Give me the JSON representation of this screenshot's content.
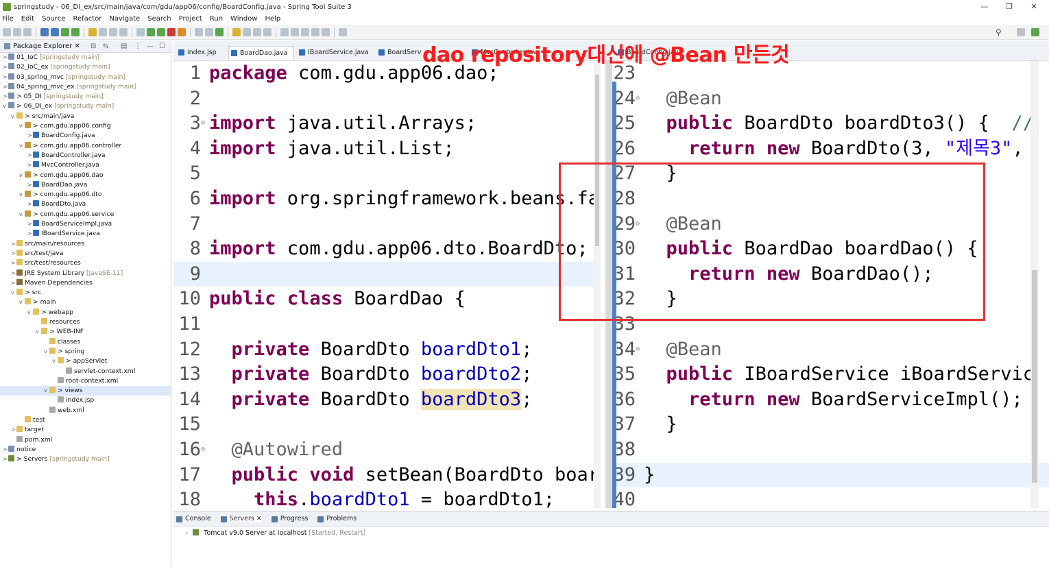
{
  "window": {
    "title": "springstudy - 06_DI_ex/src/main/java/com/gdu/app06/config/BoardConfig.java - Spring Tool Suite 3",
    "controls": [
      "—",
      "❐",
      "✕"
    ]
  },
  "menu": [
    "File",
    "Edit",
    "Source",
    "Refactor",
    "Navigate",
    "Search",
    "Project",
    "Run",
    "Window",
    "Help"
  ],
  "package_explorer": {
    "title": "Package Explorer ✕",
    "items": [
      {
        "text": "01_IoC",
        "dim": "[springstudy main]",
        "icon": "proj",
        "indent": 0,
        "tw": ">"
      },
      {
        "text": "02_IoC_ex",
        "dim": "[springstudy main]",
        "icon": "proj",
        "indent": 0,
        "tw": ">"
      },
      {
        "text": "03_spring_mvc",
        "dim": "[springstudy main]",
        "icon": "proj",
        "indent": 0,
        "tw": ">"
      },
      {
        "text": "04_spring_mvc_ex",
        "dim": "[springstudy main]",
        "icon": "proj",
        "indent": 0,
        "tw": ">"
      },
      {
        "text": "> 05_DI",
        "dim": "[springstudy main]",
        "icon": "proj",
        "indent": 0,
        "tw": ">"
      },
      {
        "text": "> 06_DI_ex",
        "dim": "[springstudy main]",
        "icon": "proj",
        "indent": 0,
        "tw": "v"
      },
      {
        "text": "> src/main/java",
        "dim": "",
        "icon": "fold",
        "indent": 1,
        "tw": "v"
      },
      {
        "text": "> com.gdu.app06.config",
        "dim": "",
        "icon": "pkg",
        "indent": 2,
        "tw": "v"
      },
      {
        "text": "BoardConfig.java",
        "dim": "",
        "icon": "java",
        "indent": 3,
        "tw": ">"
      },
      {
        "text": "> com.gdu.app06.controller",
        "dim": "",
        "icon": "pkg",
        "indent": 2,
        "tw": "v"
      },
      {
        "text": "BoardController.java",
        "dim": "",
        "icon": "java",
        "indent": 3,
        "tw": ">"
      },
      {
        "text": "MvcController.java",
        "dim": "",
        "icon": "java",
        "indent": 3,
        "tw": ">"
      },
      {
        "text": "> com.gdu.app06.dao",
        "dim": "",
        "icon": "pkg",
        "indent": 2,
        "tw": "v"
      },
      {
        "text": "BoardDao.java",
        "dim": "",
        "icon": "java",
        "indent": 3,
        "tw": ">"
      },
      {
        "text": "> com.gdu.app06.dto",
        "dim": "",
        "icon": "pkg",
        "indent": 2,
        "tw": "v"
      },
      {
        "text": "BoardDto.java",
        "dim": "",
        "icon": "java",
        "indent": 3,
        "tw": ">"
      },
      {
        "text": "> com.gdu.app06.service",
        "dim": "",
        "icon": "pkg",
        "indent": 2,
        "tw": "v"
      },
      {
        "text": "BoardServiceImpl.java",
        "dim": "",
        "icon": "java",
        "indent": 3,
        "tw": ">"
      },
      {
        "text": "IBoardService.java",
        "dim": "",
        "icon": "java",
        "indent": 3,
        "tw": ">"
      },
      {
        "text": "src/main/resources",
        "dim": "",
        "icon": "fold",
        "indent": 1,
        "tw": ">"
      },
      {
        "text": "src/test/java",
        "dim": "",
        "icon": "fold",
        "indent": 1,
        "tw": ">"
      },
      {
        "text": "src/test/resources",
        "dim": "",
        "icon": "fold",
        "indent": 1,
        "tw": ">"
      },
      {
        "text": "JRE System Library",
        "dim": "[JavaSE-11]",
        "icon": "lib",
        "indent": 1,
        "tw": ">"
      },
      {
        "text": "Maven Dependencies",
        "dim": "",
        "icon": "lib",
        "indent": 1,
        "tw": ">"
      },
      {
        "text": "> src",
        "dim": "",
        "icon": "fold",
        "indent": 1,
        "tw": "v"
      },
      {
        "text": "> main",
        "dim": "",
        "icon": "fold",
        "indent": 2,
        "tw": "v"
      },
      {
        "text": "> webapp",
        "dim": "",
        "icon": "fold",
        "indent": 3,
        "tw": "v"
      },
      {
        "text": "resources",
        "dim": "",
        "icon": "fold",
        "indent": 4,
        "tw": ""
      },
      {
        "text": "> WEB-INF",
        "dim": "",
        "icon": "fold",
        "indent": 4,
        "tw": "v"
      },
      {
        "text": "classes",
        "dim": "",
        "icon": "fold",
        "indent": 5,
        "tw": ""
      },
      {
        "text": "> spring",
        "dim": "",
        "icon": "fold",
        "indent": 5,
        "tw": "v"
      },
      {
        "text": "> appServlet",
        "dim": "",
        "icon": "fold",
        "indent": 6,
        "tw": "v"
      },
      {
        "text": "servlet-context.xml",
        "dim": "",
        "icon": "file",
        "indent": 7,
        "tw": ""
      },
      {
        "text": "root-context.xml",
        "dim": "",
        "icon": "file",
        "indent": 6,
        "tw": ""
      },
      {
        "text": "> views",
        "dim": "",
        "icon": "fold",
        "indent": 5,
        "tw": "v",
        "selected": true
      },
      {
        "text": "index.jsp",
        "dim": "",
        "icon": "file",
        "indent": 6,
        "tw": ""
      },
      {
        "text": "web.xml",
        "dim": "",
        "icon": "file",
        "indent": 5,
        "tw": ""
      },
      {
        "text": "test",
        "dim": "",
        "icon": "fold",
        "indent": 2,
        "tw": ""
      },
      {
        "text": "target",
        "dim": "",
        "icon": "fold",
        "indent": 1,
        "tw": ">"
      },
      {
        "text": "pom.xml",
        "dim": "",
        "icon": "file",
        "indent": 1,
        "tw": ""
      },
      {
        "text": "notice",
        "dim": "",
        "icon": "proj",
        "indent": 0,
        "tw": ">"
      },
      {
        "text": "> Servers",
        "dim": "[springstudy main]",
        "icon": "srv",
        "indent": 0,
        "tw": ">"
      }
    ]
  },
  "editor_tabs": [
    {
      "label": "index.jsp",
      "active": false
    },
    {
      "label": "BoardDao.java ✕",
      "active": true
    },
    {
      "label": "IBoardService.java",
      "active": false
    },
    {
      "label": "BoardServiceImpl.java",
      "active": false
    },
    {
      "label": "MvcController.java",
      "active": false
    },
    {
      "label": "BoardConfig.java",
      "active": false
    }
  ],
  "left_editor": {
    "lines": [
      {
        "n": "1",
        "fold": "",
        "html": "<span class='kw'>package</span> com.gdu.app06.dao;"
      },
      {
        "n": "2",
        "fold": "",
        "html": ""
      },
      {
        "n": "3",
        "fold": "⊖",
        "html": "<span class='kw'>import</span> java.util.Arrays;"
      },
      {
        "n": "4",
        "fold": "",
        "html": "<span class='kw'>import</span> java.util.List;"
      },
      {
        "n": "5",
        "fold": "",
        "html": ""
      },
      {
        "n": "6",
        "fold": "",
        "html": "<span class='kw'>import</span> org.springframework.beans.fa"
      },
      {
        "n": "7",
        "fold": "",
        "html": ""
      },
      {
        "n": "8",
        "fold": "",
        "html": "<span class='kw'>import</span> com.gdu.app06.dto.BoardDto;"
      },
      {
        "n": "9",
        "fold": "",
        "html": "",
        "hl": true
      },
      {
        "n": "10",
        "fold": "",
        "html": "<span class='kw'>public</span> <span class='kw'>class</span> BoardDao {"
      },
      {
        "n": "11",
        "fold": "",
        "html": ""
      },
      {
        "n": "12",
        "fold": "",
        "html": "  <span class='kw'>private</span> BoardDto <span class='fld'>boardDto1</span>;"
      },
      {
        "n": "13",
        "fold": "",
        "html": "  <span class='kw'>private</span> BoardDto <span class='fld'>boardDto2</span>;"
      },
      {
        "n": "14",
        "fold": "",
        "html": "  <span class='kw'>private</span> BoardDto <span class='fld occ'>boardDto3</span>;"
      },
      {
        "n": "15",
        "fold": "",
        "html": ""
      },
      {
        "n": "16",
        "fold": "⊖",
        "html": "  <span class='ann'>@Autowired</span>"
      },
      {
        "n": "17",
        "fold": "",
        "html": "  <span class='kw'>public</span> <span class='kw'>void</span> setBean(BoardDto boar"
      },
      {
        "n": "18",
        "fold": "",
        "html": "    <span class='kw'>this</span>.<span class='fld'>boardDto1</span> = boardDto1;"
      }
    ]
  },
  "right_editor": {
    "lines": [
      {
        "n": "23",
        "fold": "",
        "html": ""
      },
      {
        "n": "24",
        "fold": "⊖",
        "html": "  <span class='ann'>@Bean</span>"
      },
      {
        "n": "25",
        "fold": "",
        "html": "  <span class='kw'>public</span> BoardDto boardDto3() {  <span class='cm'>//</span>"
      },
      {
        "n": "26",
        "fold": "",
        "html": "    <span class='kw'>return</span> <span class='kw'>new</span> BoardDto(3, <span class='str'>\"제목3\"</span>,"
      },
      {
        "n": "27",
        "fold": "",
        "html": "  }"
      },
      {
        "n": "28",
        "fold": "",
        "html": ""
      },
      {
        "n": "29",
        "fold": "⊖",
        "html": "  <span class='ann'>@Bean</span>"
      },
      {
        "n": "30",
        "fold": "",
        "html": "  <span class='kw'>public</span> BoardDao boardDao() {"
      },
      {
        "n": "31",
        "fold": "",
        "html": "    <span class='kw'>return</span> <span class='kw'>new</span> BoardDao();"
      },
      {
        "n": "32",
        "fold": "",
        "html": "  }"
      },
      {
        "n": "33",
        "fold": "",
        "html": ""
      },
      {
        "n": "34",
        "fold": "⊖",
        "html": "  <span class='ann'>@Bean</span>"
      },
      {
        "n": "35",
        "fold": "",
        "html": "  <span class='kw'>public</span> IBoardService iBoardServic"
      },
      {
        "n": "36",
        "fold": "",
        "html": "    <span class='kw'>return</span> <span class='kw'>new</span> BoardServiceImpl();"
      },
      {
        "n": "37",
        "fold": "",
        "html": "  }"
      },
      {
        "n": "38",
        "fold": "",
        "html": ""
      },
      {
        "n": "39",
        "fold": "",
        "html": "}",
        "hl": true
      },
      {
        "n": "40",
        "fold": "",
        "html": ""
      }
    ]
  },
  "annotation_overlay": "dao repository대신에 @Bean 만든것",
  "bottom_tabs": [
    {
      "label": "Console",
      "active": false
    },
    {
      "label": "Servers ✕",
      "active": true
    },
    {
      "label": "Progress",
      "active": false
    },
    {
      "label": "Problems",
      "active": false
    }
  ],
  "servers": {
    "name": "Tomcat v9.0 Server at localhost",
    "status": "[Started, Restart]"
  }
}
